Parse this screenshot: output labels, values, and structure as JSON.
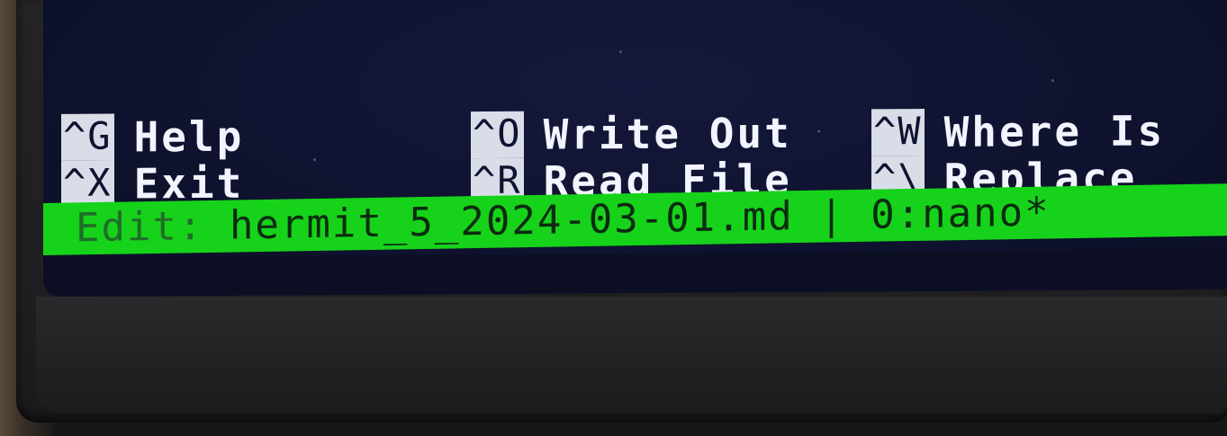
{
  "nano": {
    "shortcuts_row1": [
      {
        "key": "^G",
        "label": "Help"
      },
      {
        "key": "^O",
        "label": "Write Out"
      },
      {
        "key": "^W",
        "label": "Where Is"
      }
    ],
    "shortcuts_row2": [
      {
        "key": "^X",
        "label": "Exit"
      },
      {
        "key": "^R",
        "label": "Read File"
      },
      {
        "key": "^\\",
        "label": "Replace"
      }
    ],
    "status_bar": {
      "prefix": "Edit:",
      "text": " hermit_5_2024-03-01.md | 0:nano*"
    }
  },
  "colors": {
    "screen_background": "#0f1330",
    "status_bar": "#17d21a",
    "key_highlight": "#d9dde8",
    "text": "#f2f4ff"
  }
}
